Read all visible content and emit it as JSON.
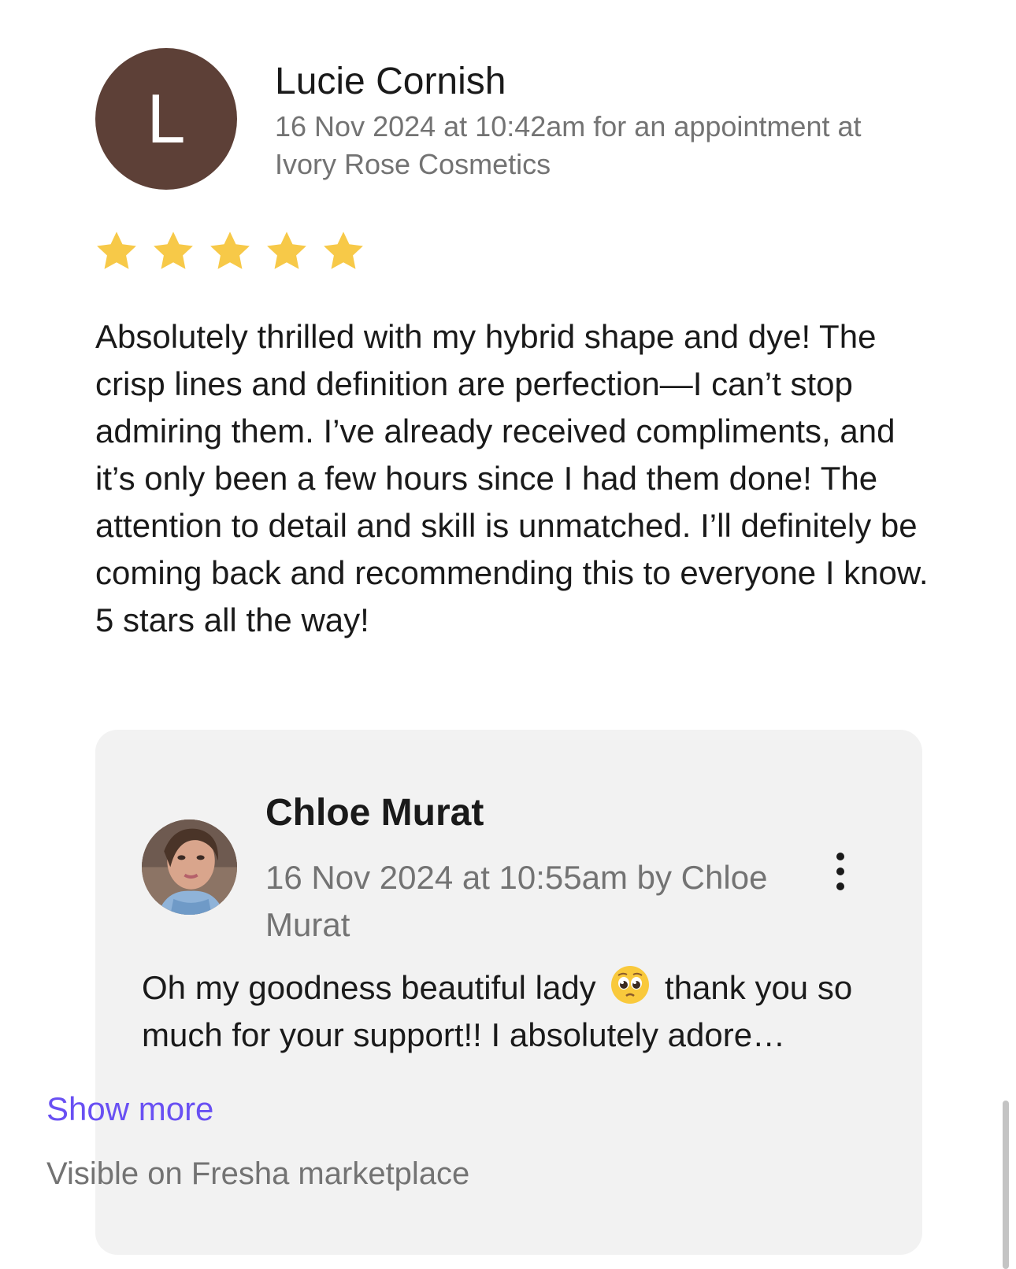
{
  "review": {
    "avatar_initial": "L",
    "avatar_color": "#5d4037",
    "reviewer_name": "Lucie Cornish",
    "meta": "16 Nov 2024 at 10:42am for an appointment at Ivory Rose Cosmetics",
    "rating": 5,
    "rating_max": 5,
    "star_color": "#f7c948",
    "body": "Absolutely thrilled with my hybrid shape and dye! The crisp lines and definition are perfection—I can’t stop admiring them. I’ve already received compliments, and it’s only been a few hours since I had them done! The attention to detail and skill is unmatched. I’ll definitely be coming back and recommending this to everyone I know. 5 stars all the way!"
  },
  "reply": {
    "owner_name": "Chloe Murat",
    "meta": "16 Nov 2024 at 10:55am by Chloe Murat",
    "text_before_emoji": "Oh my goodness beautiful lady",
    "emoji": "pleading-face-emoji",
    "text_after_emoji": "thank you so much for your support!! I absolutely adore…",
    "show_more_label": "Show more",
    "visibility": "Visible on Fresha marketplace",
    "link_color": "#6950f3",
    "more_options_icon": "vertical-ellipsis-icon"
  }
}
